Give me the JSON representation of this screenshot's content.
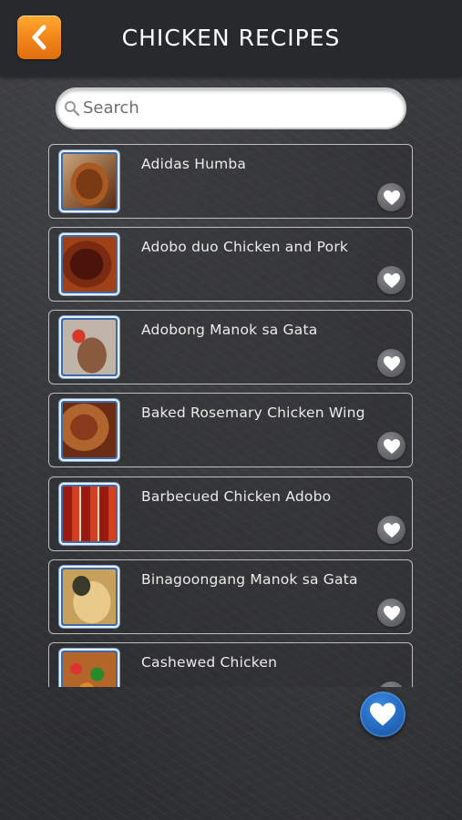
{
  "header": {
    "title": "CHICKEN RECIPES"
  },
  "search": {
    "placeholder": "Search",
    "value": ""
  },
  "recipes": [
    {
      "name": "Adidas Humba"
    },
    {
      "name": "Adobo duo Chicken and Pork"
    },
    {
      "name": "Adobong Manok sa Gata"
    },
    {
      "name": "Baked Rosemary Chicken Wing"
    },
    {
      "name": "Barbecued Chicken Adobo"
    },
    {
      "name": "Binagoongang Manok sa Gata"
    },
    {
      "name": "Cashewed Chicken"
    }
  ],
  "colors": {
    "accent_orange": "#f2831a",
    "fab_blue": "#1d5fb2",
    "header_bg": "#27292d"
  }
}
